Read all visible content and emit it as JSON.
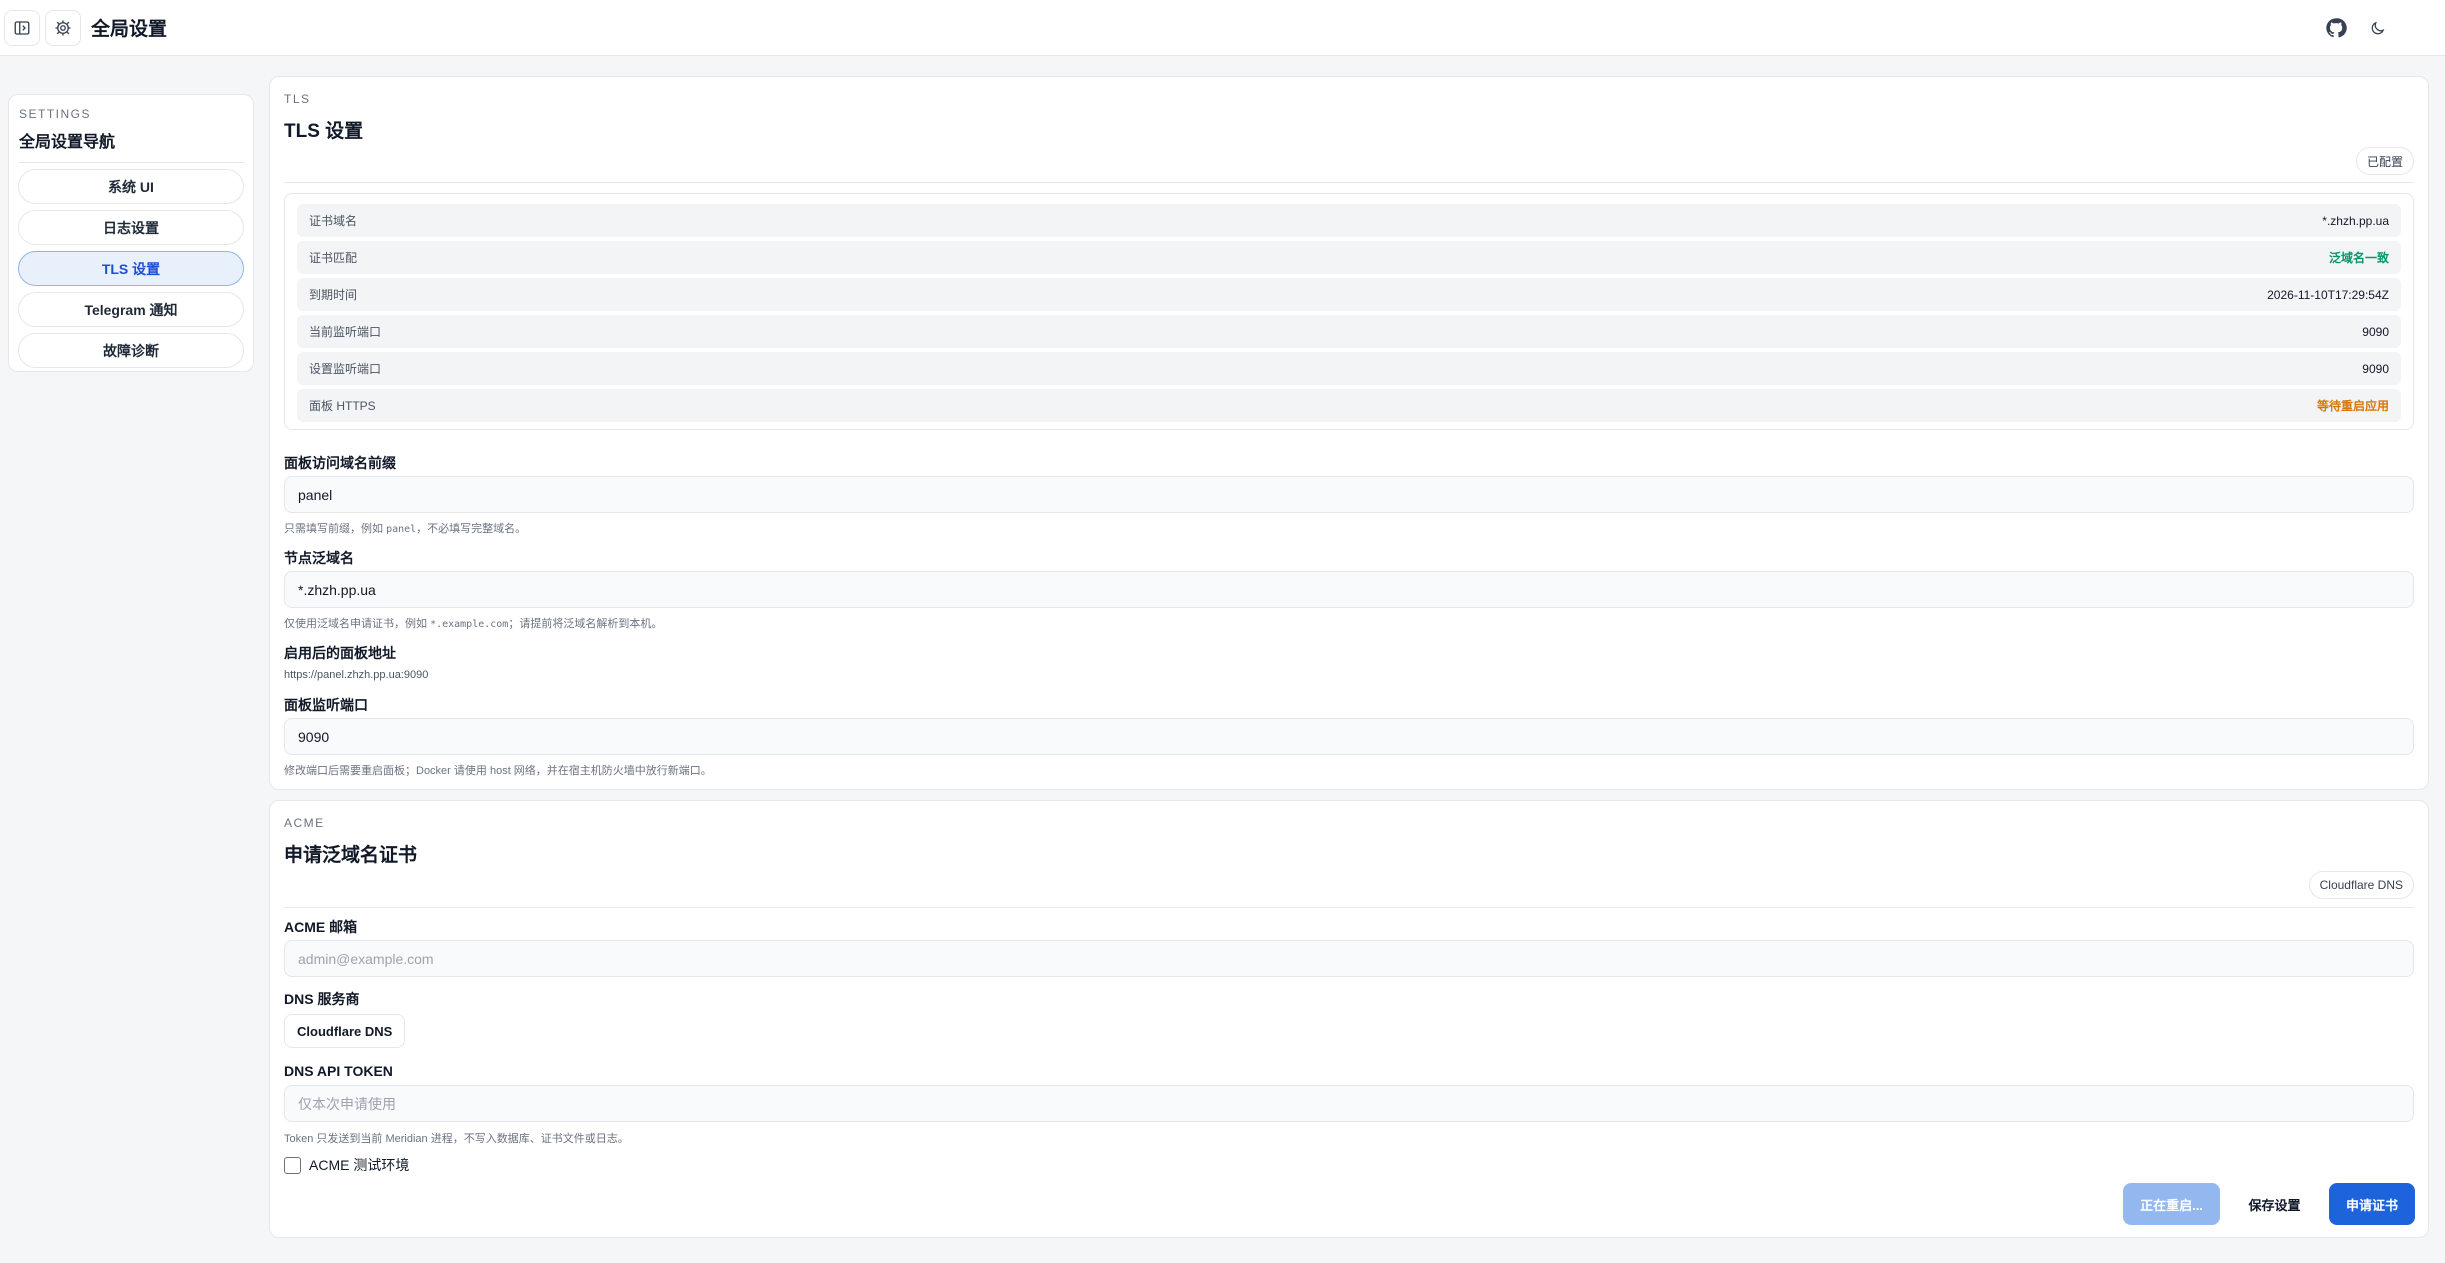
{
  "header": {
    "title": "全局设置"
  },
  "sidebar": {
    "kicker": "SETTINGS",
    "title": "全局设置导航",
    "items": [
      {
        "label": "系统 UI"
      },
      {
        "label": "日志设置"
      },
      {
        "label": "TLS 设置"
      },
      {
        "label": "Telegram 通知"
      },
      {
        "label": "故障诊断"
      }
    ],
    "active_index": 2
  },
  "tls": {
    "kicker": "TLS",
    "title": "TLS 设置",
    "status_pill": "已配置",
    "info": [
      {
        "key": "证书域名",
        "value": "*.zhzh.pp.ua"
      },
      {
        "key": "证书匹配",
        "value": "泛域名一致"
      },
      {
        "key": "到期时间",
        "value": "2026-11-10T17:29:54Z"
      },
      {
        "key": "当前监听端口",
        "value": "9090"
      },
      {
        "key": "设置监听端口",
        "value": "9090"
      },
      {
        "key": "面板 HTTPS",
        "value": "等待重启应用"
      }
    ],
    "prefix_label": "面板访问域名前缀",
    "prefix_value": "panel",
    "prefix_help_a": "只需填写前缀，例如 ",
    "prefix_help_code": "panel",
    "prefix_help_b": "，不必填写完整域名。",
    "wildcard_label": "节点泛域名",
    "wildcard_value": "*.zhzh.pp.ua",
    "wildcard_help_a": "仅使用泛域名申请证书，例如 ",
    "wildcard_help_code": "*.example.com",
    "wildcard_help_b": "；请提前将泛域名解析到本机。",
    "url_label": "启用后的面板地址",
    "url_value": "https://panel.zhzh.pp.ua:9090",
    "port_label": "面板监听端口",
    "port_value": "9090",
    "port_help": "修改端口后需要重启面板；Docker 请使用 host 网络，并在宿主机防火墙中放行新端口。"
  },
  "acme": {
    "kicker": "ACME",
    "title": "申请泛域名证书",
    "provider_pill": "Cloudflare DNS",
    "email_label": "ACME 邮箱",
    "email_placeholder": "admin@example.com",
    "dns_label": "DNS 服务商",
    "dns_value": "Cloudflare DNS",
    "token_label": "DNS API TOKEN",
    "token_placeholder": "仅本次申请使用",
    "token_help": "Token 只发送到当前 Meridian 进程，不写入数据库、证书文件或日志。",
    "staging_label": "ACME 测试环境",
    "btn_restarting": "正在重启...",
    "btn_save": "保存设置",
    "btn_apply": "申请证书"
  }
}
